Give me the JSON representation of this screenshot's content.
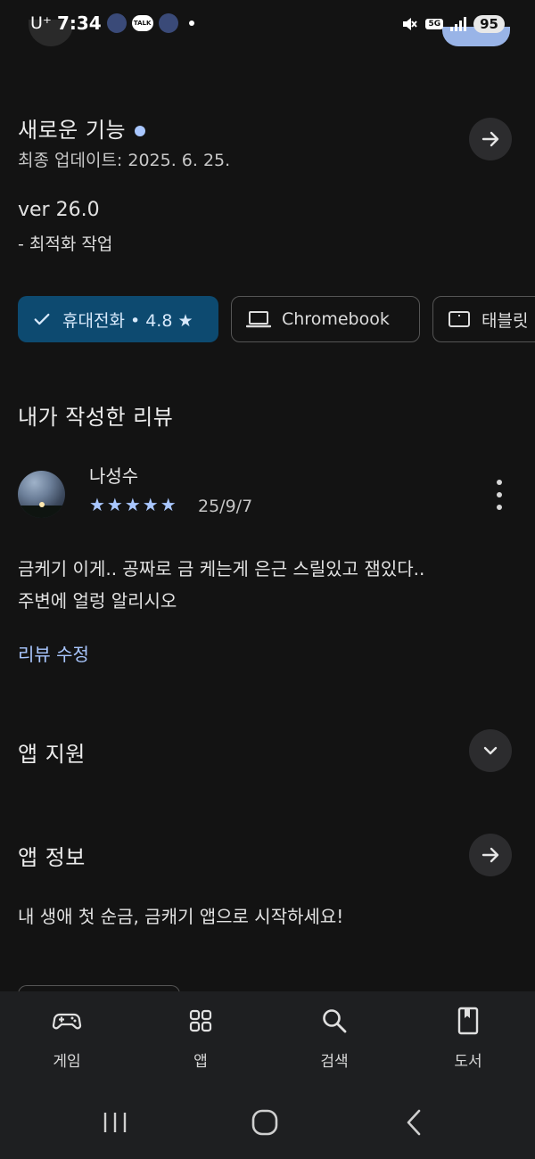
{
  "status_bar": {
    "carrier": "U⁺",
    "time": "7:34",
    "talk_label": "TALK",
    "network": "5G",
    "battery": "95"
  },
  "whats_new": {
    "title": "새로운 기능",
    "updated": "최종 업데이트: 2025. 6. 25.",
    "version": "ver 26.0",
    "note": "- 최적화 작업"
  },
  "devices": {
    "phone": "휴대전화 • 4.8 ★",
    "chromebook": "Chromebook",
    "tablet": "태블릿"
  },
  "my_review": {
    "heading": "내가 작성한 리뷰",
    "reviewer": "나성수",
    "stars": "★★★★★",
    "rating": 5,
    "date": "25/9/7",
    "body_line1": "금케기 이게.. 공짜로 금 케는게 은근 스릴있고 잼있다..",
    "body_line2": "주변에 얼렁 알리시오",
    "edit_label": "리뷰 수정"
  },
  "app_support": {
    "title": "앱 지원"
  },
  "app_info": {
    "title": "앱 정보",
    "description": "내 생애 첫 순금, 금캐기 앱으로 시작하세요!"
  },
  "bottom_nav": {
    "games": "게임",
    "apps": "앱",
    "search": "검색",
    "books": "도서"
  },
  "colors": {
    "background": "#131313",
    "accent": "#a9c7ff",
    "selected_chip": "#0d4a70",
    "nav_bg": "#1e1f21"
  }
}
